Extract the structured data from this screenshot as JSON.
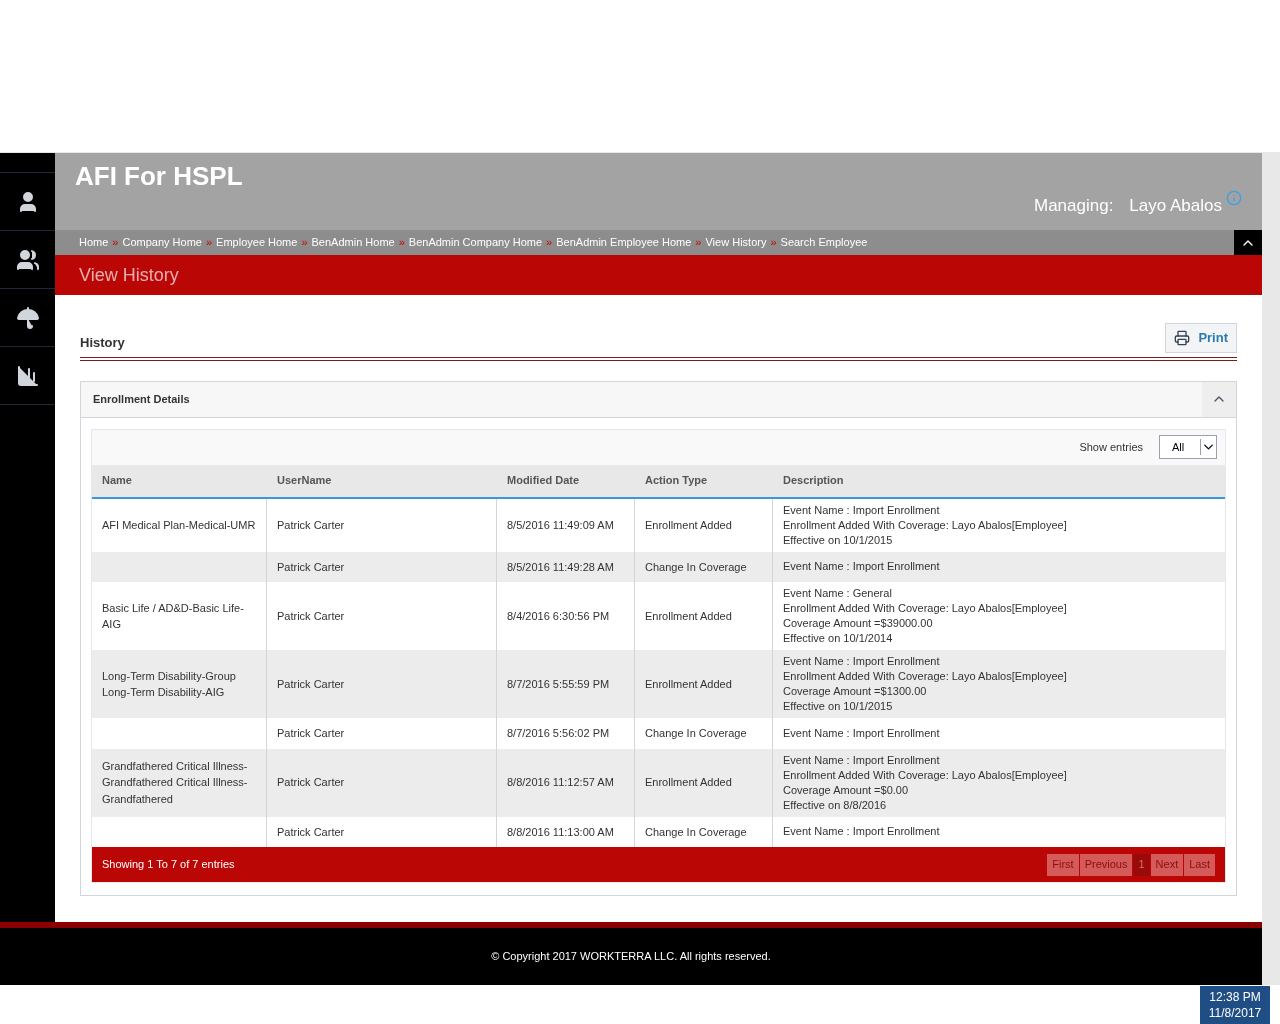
{
  "header": {
    "title": "AFI For HSPL",
    "managing_label": "Managing:",
    "managing_name": "Layo Abalos"
  },
  "breadcrumb_separator": "»",
  "breadcrumbs": [
    "Home",
    "Company Home",
    "Employee Home",
    "BenAdmin Home",
    "BenAdmin Company Home",
    "BenAdmin Employee Home",
    "View History",
    "Search Employee"
  ],
  "page_title": "View History",
  "section": {
    "title": "History",
    "print_button": "Print"
  },
  "panel": {
    "title": "Enrollment Details",
    "expanded": true,
    "show_entries_label": "Show entries",
    "show_entries_value": "All"
  },
  "table": {
    "columns": [
      "Name",
      "UserName",
      "Modified Date",
      "Action Type",
      "Description"
    ],
    "rows": [
      {
        "name": "AFI Medical Plan-Medical-UMR",
        "username": "Patrick Carter",
        "modified": "8/5/2016 11:49:09 AM",
        "action": "Enrollment Added",
        "description": [
          "Event Name : Import Enrollment",
          "Enrollment Added With Coverage: Layo Abalos[Employee]",
          "Effective on 10/1/2015"
        ]
      },
      {
        "username": "Patrick Carter",
        "modified": "8/5/2016 11:49:28 AM",
        "action": "Change In Coverage",
        "description": [
          "Event Name : Import Enrollment"
        ]
      },
      {
        "name": "Basic Life / AD&D-Basic Life-AIG",
        "username": "Patrick Carter",
        "modified": "8/4/2016 6:30:56 PM",
        "action": "Enrollment Added",
        "description": [
          "Event Name : General",
          "Enrollment Added With Coverage: Layo Abalos[Employee]",
          "Coverage Amount =$39000.00",
          "Effective on 10/1/2014"
        ]
      },
      {
        "name": "Long-Term Disability-Group Long-Term Disability-AIG",
        "username": "Patrick Carter",
        "modified": "8/7/2016 5:55:59 PM",
        "action": "Enrollment Added",
        "description": [
          "Event Name : Import Enrollment",
          "Enrollment Added With Coverage: Layo Abalos[Employee]",
          "Coverage Amount =$1300.00",
          "Effective on 10/1/2015"
        ]
      },
      {
        "username": "Patrick Carter",
        "modified": "8/7/2016 5:56:02 PM",
        "action": "Change In Coverage",
        "description": [
          "Event Name : Import Enrollment"
        ]
      },
      {
        "name": "Grandfathered Critical Illness-Grandfathered Critical Illness-Grandfathered",
        "username": "Patrick Carter",
        "modified": "8/8/2016 11:12:57 AM",
        "action": "Enrollment Added",
        "description": [
          "Event Name : Import Enrollment",
          "Enrollment Added With Coverage: Layo Abalos[Employee]",
          "Coverage Amount =$0.00",
          "Effective on 8/8/2016"
        ]
      },
      {
        "username": "Patrick Carter",
        "modified": "8/8/2016 11:13:00 AM",
        "action": "Change In Coverage",
        "description": [
          "Event Name : Import Enrollment"
        ]
      }
    ]
  },
  "footer_info": "Showing 1 To 7 of 7 entries",
  "pagination": [
    {
      "label": "First",
      "selected": false
    },
    {
      "label": "Previous",
      "selected": false
    },
    {
      "label": "1",
      "selected": true
    },
    {
      "label": "Next",
      "selected": false
    },
    {
      "label": "Last",
      "selected": false
    }
  ],
  "copyright": "© Copyright 2017 WORKTERRA LLC. All rights reserved.",
  "taskbar": {
    "time": "12:38 PM",
    "date": "11/8/2017"
  }
}
